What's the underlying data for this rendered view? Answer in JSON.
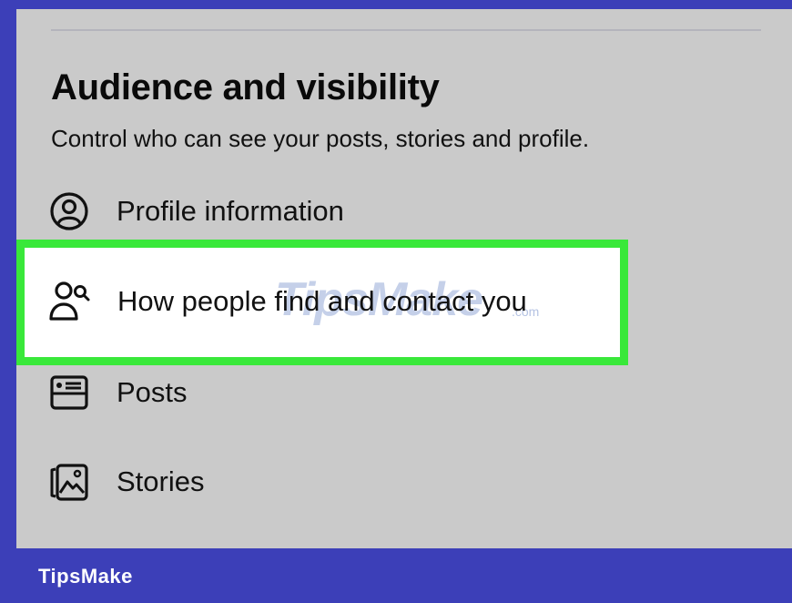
{
  "section": {
    "title": "Audience and visibility",
    "subtitle": "Control who can see your posts, stories and profile."
  },
  "items": [
    {
      "label": "Profile information",
      "icon": "profile-circle-icon"
    },
    {
      "label": "How people find and contact you",
      "icon": "people-search-icon",
      "highlighted": true
    },
    {
      "label": "Posts",
      "icon": "posts-card-icon"
    },
    {
      "label": "Stories",
      "icon": "stories-image-icon"
    }
  ],
  "watermark": {
    "text": "TipsMake",
    "suffix": ".com"
  },
  "footer": {
    "brand": "TipsMake"
  },
  "colors": {
    "frame": "#3c3fb8",
    "highlight_border": "#39e83a",
    "screen_bg": "#cacaca"
  }
}
